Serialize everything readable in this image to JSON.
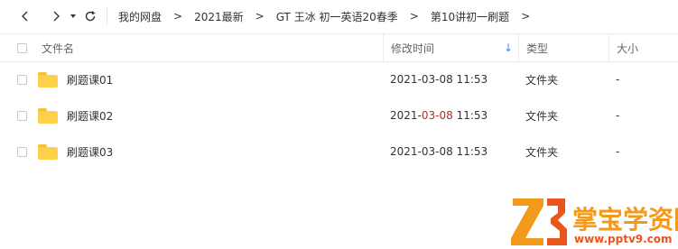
{
  "toolbar": {
    "back_icon": "chevron-left-icon",
    "forward_icon": "chevron-right-icon",
    "history_icon": "caret-down-icon",
    "refresh_icon": "refresh-icon",
    "breadcrumbs": [
      "我的网盘",
      "2021最新",
      "GT 王冰 初一英语20春季",
      "第10讲初一刷题"
    ],
    "separator": ">"
  },
  "header": {
    "name": "文件名",
    "date": "修改时间",
    "sort_indicator": "↓",
    "type": "类型",
    "size": "大小"
  },
  "files": [
    {
      "name": "刷题课01",
      "date": "2021-03-08 11:53",
      "type": "文件夹",
      "size": "-"
    },
    {
      "name": "刷题课02",
      "date_prefix": "2021-",
      "date_red": "03-08",
      "date_suffix": " 11:53",
      "type": "文件夹",
      "size": "-"
    },
    {
      "name": "刷题课03",
      "date": "2021-03-08 11:53",
      "type": "文件夹",
      "size": "-"
    }
  ],
  "watermark": {
    "title": "掌宝学资网",
    "url": "www.pptv9.com"
  },
  "colors": {
    "folder": "#fdd04a",
    "sort_arrow": "#3b8cf0",
    "logo_orange": "#f39a1b"
  }
}
